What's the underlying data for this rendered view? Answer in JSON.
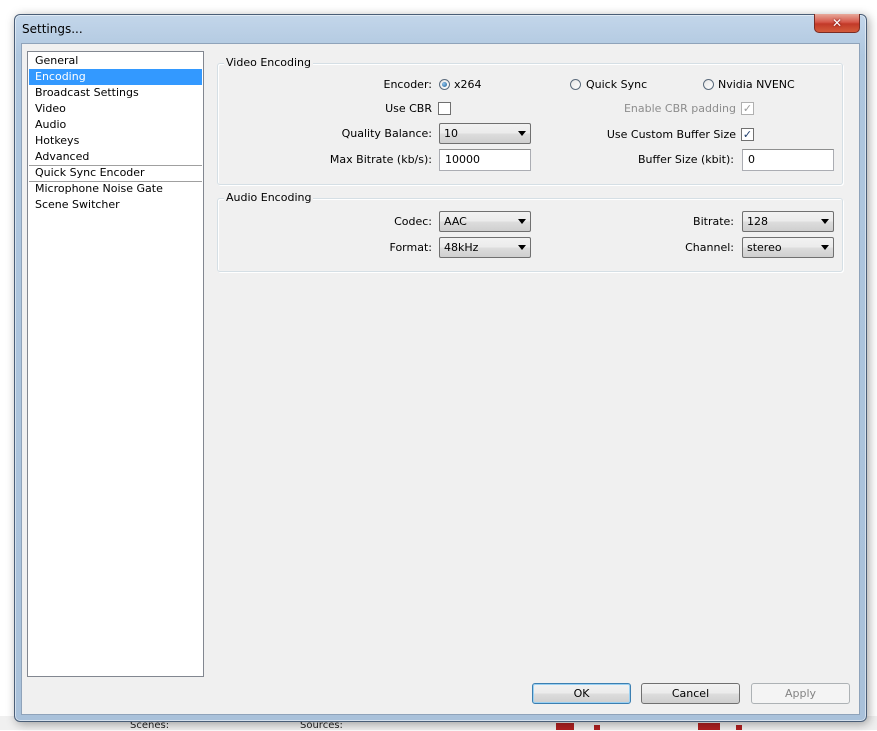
{
  "window": {
    "title": "Settings...",
    "close_glyph": "✕"
  },
  "background": {
    "label_scenes": "Scenes:",
    "label_sources": "Sources:"
  },
  "nav": {
    "items": [
      {
        "label": "General"
      },
      {
        "label": "Encoding",
        "selected": true
      },
      {
        "label": "Broadcast Settings"
      },
      {
        "label": "Video"
      },
      {
        "label": "Audio"
      },
      {
        "label": "Hotkeys"
      },
      {
        "label": "Advanced"
      },
      {
        "label": "Quick Sync Encoder"
      },
      {
        "label": "Microphone Noise Gate"
      },
      {
        "label": "Scene Switcher"
      }
    ]
  },
  "video": {
    "title": "Video Encoding",
    "encoder_label": "Encoder:",
    "encoder_options": [
      "x264",
      "Quick Sync",
      "Nvidia NVENC"
    ],
    "encoder_selected": "x264",
    "use_cbr_label": "Use CBR",
    "use_cbr": false,
    "cbr_padding_label": "Enable CBR padding",
    "cbr_padding": true,
    "quality_label": "Quality Balance:",
    "quality_value": "10",
    "custom_buffer_label": "Use Custom Buffer Size",
    "custom_buffer": true,
    "max_bitrate_label": "Max Bitrate (kb/s):",
    "max_bitrate_value": "10000",
    "buffer_size_label": "Buffer Size (kbit):",
    "buffer_size_value": "0"
  },
  "audio": {
    "title": "Audio Encoding",
    "codec_label": "Codec:",
    "codec_value": "AAC",
    "bitrate_label": "Bitrate:",
    "bitrate_value": "128",
    "format_label": "Format:",
    "format_value": "48kHz",
    "channel_label": "Channel:",
    "channel_value": "stereo"
  },
  "buttons": {
    "ok": "OK",
    "cancel": "Cancel",
    "apply": "Apply"
  },
  "icons": {
    "check_glyph": "✓"
  },
  "colors": {
    "selection": "#3399ff",
    "close": "#c7402e"
  }
}
